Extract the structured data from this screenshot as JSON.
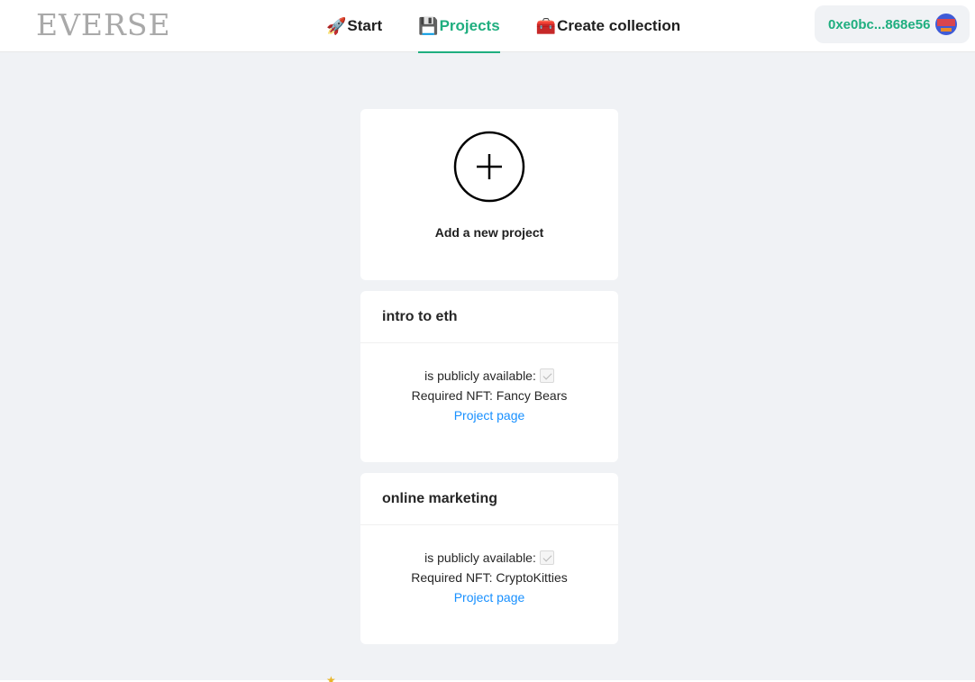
{
  "header": {
    "logo": "EVERSE",
    "nav": [
      {
        "icon": "rocket-icon",
        "emoji": "🚀",
        "label": "Start",
        "active": false
      },
      {
        "icon": "floppy-disk-icon",
        "emoji": "💾",
        "label": "Projects",
        "active": true
      },
      {
        "icon": "toolbox-icon",
        "emoji": "🧰",
        "label": "Create collection",
        "active": false
      }
    ],
    "wallet": {
      "address": "0xe0bc...868e56",
      "avatar_icon": "wallet-avatar-icon"
    }
  },
  "add_project": {
    "icon": "plus-circle-icon",
    "label": "Add a new project"
  },
  "projects": [
    {
      "title": "intro to eth",
      "public_label": "is publicly available:",
      "public": true,
      "nft_label": "Required NFT: Fancy Bears",
      "link": "Project page"
    },
    {
      "title": "online marketing",
      "public_label": "is publicly available:",
      "public": true,
      "nft_label": "Required NFT: CryptoKitties",
      "link": "Project page"
    }
  ],
  "colors": {
    "accent": "#1fae7f",
    "link": "#1890ff",
    "background": "#f0f2f5"
  }
}
